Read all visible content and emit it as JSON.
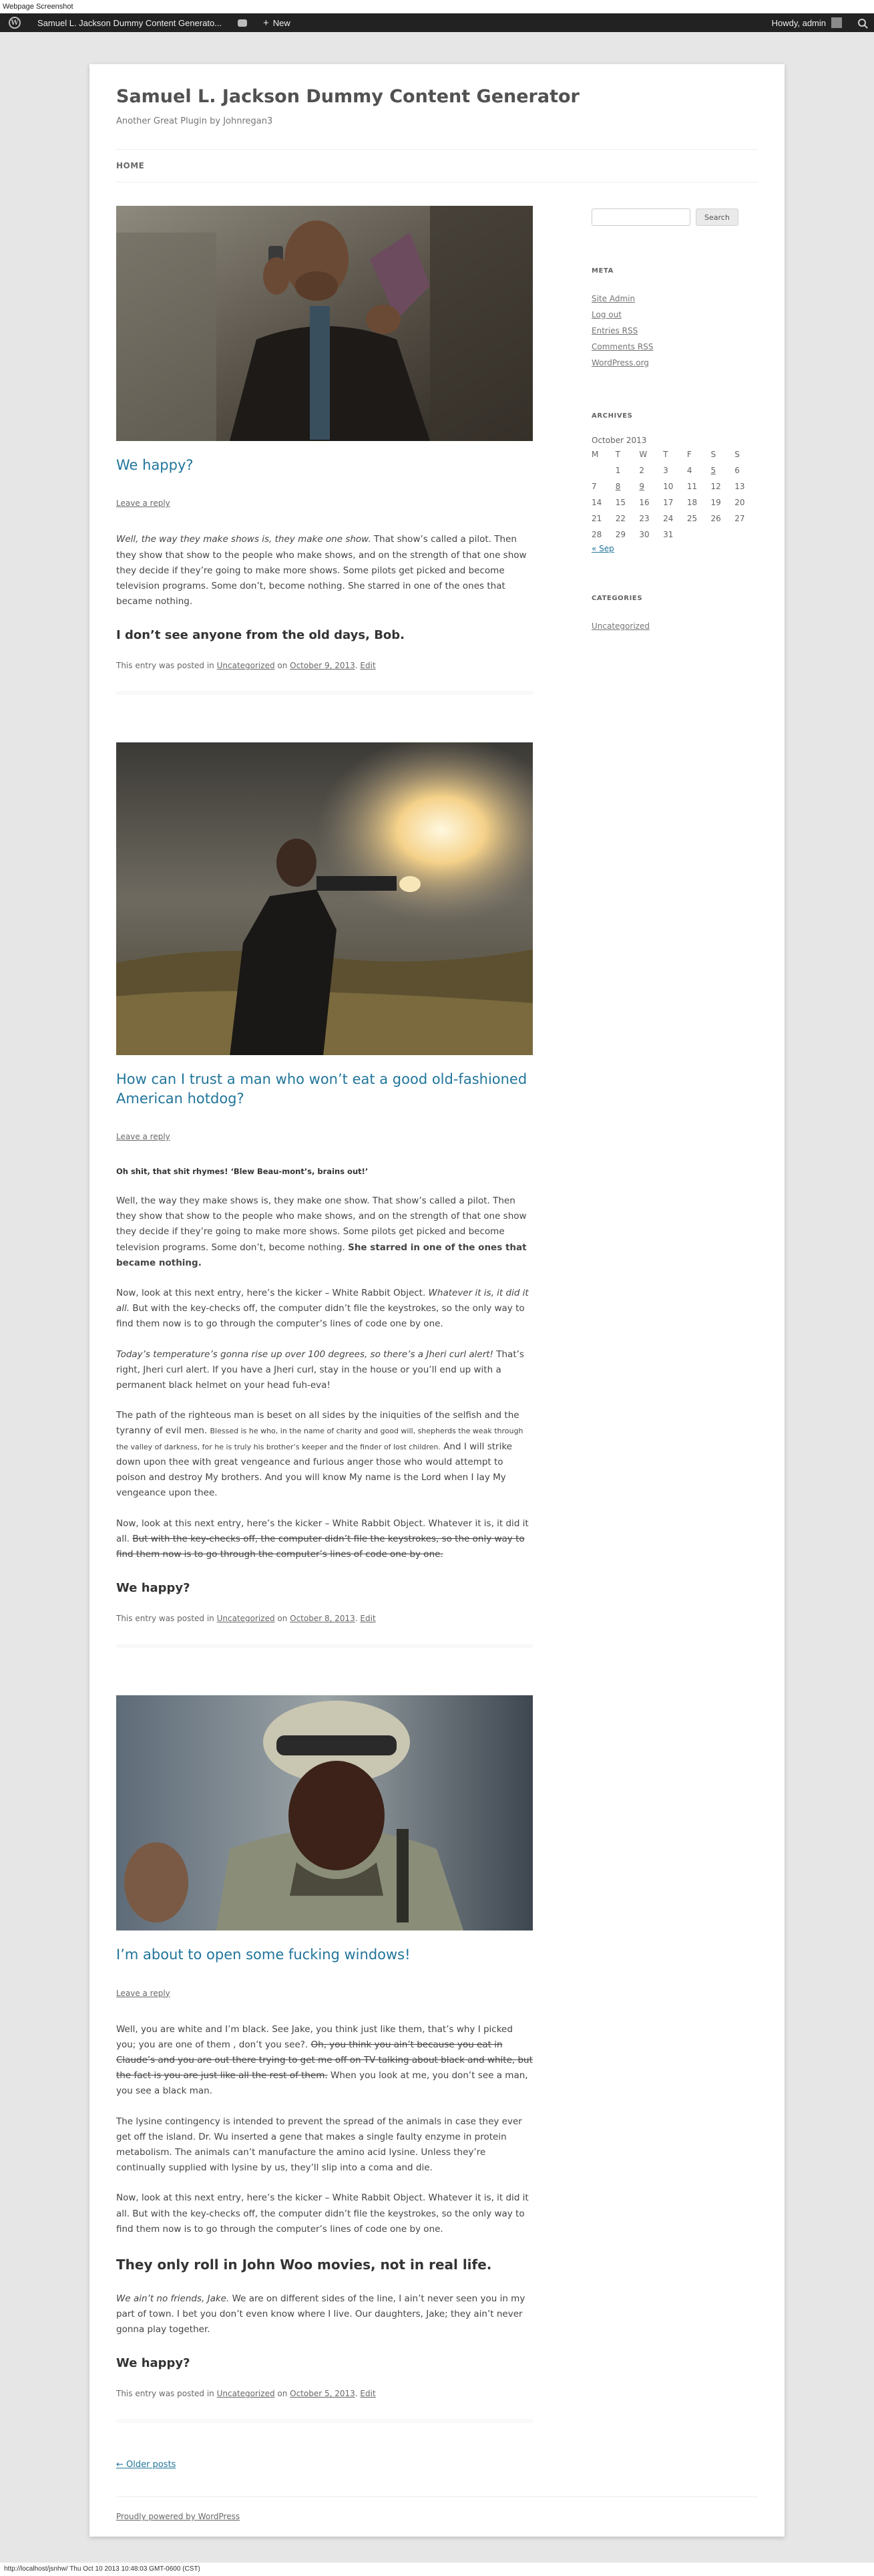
{
  "capture_title": "Webpage Screenshot",
  "adminbar": {
    "site_name": "Samuel L. Jackson Dummy Content Generato...",
    "new_label": "New",
    "howdy": "Howdy, admin"
  },
  "site": {
    "title": "Samuel L. Jackson Dummy Content Generator",
    "description": "Another Great Plugin by Johnregan3",
    "nav_home": "HOME"
  },
  "posts": [
    {
      "title": "We happy?",
      "reply": "Leave a reply",
      "p1_em": "Well, the way they make shows is, they make one show.",
      "p1_rest": " That show’s called a pilot. Then they show that show to the people who make shows, and on the strength of that one show they decide if they’re going to make more shows. Some pilots get picked and become television programs. Some don’t, become nothing. She starred in one of the ones that became nothing.",
      "h3": "I don’t see anyone from the old days, Bob.",
      "meta_pre": "This entry was posted in ",
      "meta_cat": "Uncategorized",
      "meta_on": " on ",
      "meta_date": "October 9, 2013",
      "meta_sep": ". ",
      "meta_edit": "Edit"
    },
    {
      "title": "How can I trust a man who won’t eat a good old-fashioned American hotdog?",
      "reply": "Leave a reply",
      "h6": "Oh shit, that shit rhymes! ‘Blew Beau-mont’s, brains out!’",
      "p1": "Well, the way they make shows is, they make one show. That show’s called a pilot. Then they show that show to the people who make shows, and on the strength of that one show they decide if they’re going to make more shows. Some pilots get picked and become television programs. Some don’t, become nothing. ",
      "p1_strong": "She starred in one of the ones that became nothing.",
      "p2_a": "Now, look at this next entry, here’s the kicker – White Rabbit Object. ",
      "p2_em": "Whatever it is, it did it all.",
      "p2_b": " But with the key-checks off, the computer didn’t file the keystrokes, so the only way to find them now is to go through the computer’s lines of code one by one.",
      "p3_em": "Today’s temperature’s gonna rise up over 100 degrees, so there’s a Jheri curl alert!",
      "p3_rest": " That’s right, Jheri curl alert. If you have a Jheri curl, stay in the house or you’ll end up with a permanent black helmet on your head fuh-eva!",
      "p4_a": "The path of the righteous man is beset on all sides by the iniquities of the selfish and the tyranny of evil men. ",
      "p4_small": "Blessed is he who, in the name of charity and good will, shepherds the weak through the valley of darkness, for he is truly his brother’s keeper and the finder of lost children.",
      "p4_b": " And I will strike down upon thee with great vengeance and furious anger those who would attempt to poison and destroy My brothers. And you will know My name is the Lord when I lay My vengeance upon thee.",
      "p5_a": "Now, look at this next entry, here’s the kicker – White Rabbit Object. Whatever it is, it did it all. ",
      "p5_strike": "But with the key-checks off, the computer didn’t file the keystrokes, so the only way to find them now is to go through the computer’s lines of code one by one.",
      "h3": "We happy?",
      "meta_pre": "This entry was posted in ",
      "meta_cat": "Uncategorized",
      "meta_on": " on ",
      "meta_date": "October 8, 2013",
      "meta_sep": ". ",
      "meta_edit": "Edit"
    },
    {
      "title": "I’m about to open some fucking windows!",
      "reply": "Leave a reply",
      "p1_a": "Well, you are white and I’m black. See Jake, you think just like them, that’s why I picked you; you are one of them , don’t you see?. ",
      "p1_strike": "Oh, you think you ain’t because you eat in Claude’s and you are out there trying to get me off on TV talking about black and white, but the fact is you are just like all the rest of them.",
      "p1_b": " When you look at me, you don’t see a man, you see a black man.",
      "p2": "The lysine contingency is intended to prevent the spread of the animals in case they ever get off the island. Dr. Wu inserted a gene that makes a single faulty enzyme in protein metabolism. The animals can’t manufacture the amino acid lysine. Unless they’re continually supplied with lysine by us, they’ll slip into a coma and die.",
      "p3": "Now, look at this next entry, here’s the kicker – White Rabbit Object. Whatever it is, it did it all. But with the key-checks off, the computer didn’t file the keystrokes, so the only way to find them now is to go through the computer’s lines of code one by one.",
      "h2": "They only roll in John Woo movies, not in real life.",
      "p4_em": "We ain’t no friends, Jake.",
      "p4_rest": " We are on different sides of the line, I ain’t never seen you in my part of town. I bet you don’t even know where I live. Our daughters, Jake; they ain’t never gonna play together.",
      "h3": "We happy?",
      "meta_pre": "This entry was posted in ",
      "meta_cat": "Uncategorized",
      "meta_on": " on ",
      "meta_date": "October 5, 2013",
      "meta_sep": ". ",
      "meta_edit": "Edit"
    }
  ],
  "older_posts": "← Older posts",
  "footer": "Proudly powered by WordPress",
  "sidebar": {
    "search_button": "Search",
    "meta_title": "META",
    "meta_links": [
      "Site Admin",
      "Log out",
      "Entries RSS",
      "Comments RSS",
      "WordPress.org"
    ],
    "archives_title": "ARCHIVES",
    "calendar": {
      "caption": "October 2013",
      "days": [
        "M",
        "T",
        "W",
        "T",
        "F",
        "S",
        "S"
      ],
      "weeks": [
        [
          "",
          "1",
          "2",
          "3",
          "4",
          "5",
          "6"
        ],
        [
          "7",
          "8",
          "9",
          "10",
          "11",
          "12",
          "13"
        ],
        [
          "14",
          "15",
          "16",
          "17",
          "18",
          "19",
          "20"
        ],
        [
          "21",
          "22",
          "23",
          "24",
          "25",
          "26",
          "27"
        ],
        [
          "28",
          "29",
          "30",
          "31",
          "",
          "",
          ""
        ]
      ],
      "prev": "« Sep"
    },
    "categories_title": "CATEGORIES",
    "category": "Uncategorized"
  },
  "statusbar": "http://localhost/jsnhw/ Thu Oct 10 2013 10:48:03 GMT-0600 (CST)",
  "colors": {
    "link": "#21759b",
    "adminbar": "#222222",
    "background": "#e6e6e6"
  }
}
